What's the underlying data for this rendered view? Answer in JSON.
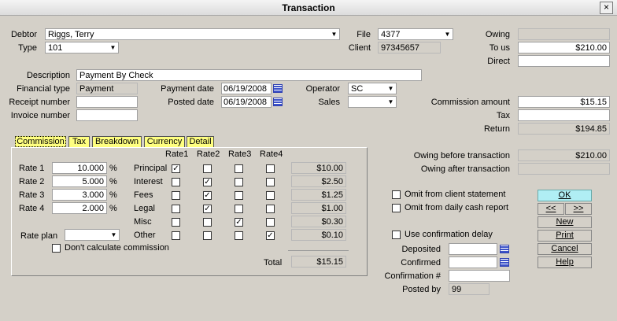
{
  "window": {
    "title": "Transaction",
    "close_label": "×"
  },
  "labels": {
    "debtor": "Debtor",
    "type": "Type",
    "file": "File",
    "client": "Client",
    "owing": "Owing",
    "to_us": "To us",
    "direct": "Direct",
    "description": "Description",
    "financial_type": "Financial type",
    "payment_date": "Payment date",
    "operator": "Operator",
    "receipt_number": "Receipt number",
    "posted_date": "Posted date",
    "sales": "Sales",
    "invoice_number": "Invoice number",
    "commission_amount": "Commission amount",
    "tax": "Tax",
    "return": "Return",
    "owing_before": "Owing before transaction",
    "owing_after": "Owing after transaction",
    "omit_client_statement": "Omit from client statement",
    "omit_daily_cash": "Omit from daily cash report",
    "use_confirmation_delay": "Use confirmation delay",
    "deposited": "Deposited",
    "confirmed": "Confirmed",
    "confirmation_num": "Confirmation #",
    "posted_by": "Posted by"
  },
  "values": {
    "debtor": "Riggs, Terry",
    "type": "101",
    "file": "4377",
    "client": "97345657",
    "owing": "",
    "to_us": "$210.00",
    "direct": "",
    "description": "Payment By Check",
    "financial_type": "Payment",
    "payment_date": "06/19/2008",
    "operator": "SC",
    "receipt_number": "",
    "posted_date": "06/19/2008",
    "sales": "",
    "invoice_number": "",
    "commission_amount": "$15.15",
    "tax": "",
    "return": "$194.85",
    "owing_before": "$210.00",
    "owing_after": "",
    "deposited": "",
    "confirmed": "",
    "confirmation_num": "",
    "posted_by": "99"
  },
  "tabs": [
    "Commission",
    "Tax",
    "Breakdown",
    "Currency",
    "Detail"
  ],
  "commission": {
    "rate_labels": [
      "Rate 1",
      "Rate 2",
      "Rate 3",
      "Rate 4"
    ],
    "rate_values": [
      "10.000",
      "5.000",
      "3.000",
      "2.000"
    ],
    "percent": "%",
    "rate_plan_label": "Rate plan",
    "rate_plan_value": "",
    "dont_calc_label": "Don't calculate commission",
    "col_headers": [
      "Rate1",
      "Rate2",
      "Rate3",
      "Rate4"
    ],
    "rows": [
      {
        "label": "Principal",
        "checks": [
          true,
          false,
          false,
          false
        ],
        "amount": "$10.00"
      },
      {
        "label": "Interest",
        "checks": [
          false,
          true,
          false,
          false
        ],
        "amount": "$2.50"
      },
      {
        "label": "Fees",
        "checks": [
          false,
          true,
          false,
          false
        ],
        "amount": "$1.25"
      },
      {
        "label": "Legal",
        "checks": [
          false,
          true,
          false,
          false
        ],
        "amount": "$1.00"
      },
      {
        "label": "Misc",
        "checks": [
          false,
          false,
          true,
          false
        ],
        "amount": "$0.30"
      },
      {
        "label": "Other",
        "checks": [
          false,
          false,
          false,
          true
        ],
        "amount": "$0.10"
      }
    ],
    "total_label": "Total",
    "total_value": "$15.15"
  },
  "buttons": {
    "ok": "OK",
    "prev": "<<",
    "next": ">>",
    "new": "New",
    "print": "Print",
    "cancel": "Cancel",
    "help": "Help"
  },
  "icons": {
    "dropdown": "▼",
    "check": "✓",
    "calendar": "calendar-icon"
  }
}
